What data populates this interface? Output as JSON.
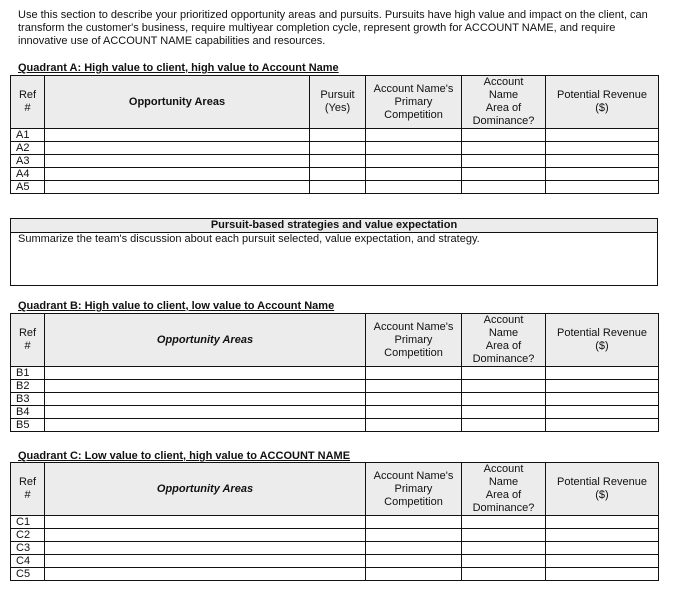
{
  "intro": "Use this section to describe your prioritized opportunity areas and pursuits.  Pursuits have high value and impact on the client, can transform the customer's business, require multiyear completion cycle, represent growth for ACCOUNT NAME, and require innovative use of ACCOUNT NAME capabilities and resources.",
  "quadrant_a": {
    "title": "Quadrant A: High value to client, high value to Account Name",
    "headers": {
      "ref_line1": "Ref",
      "ref_line2": "#",
      "opportunity": "Opportunity Areas",
      "pursuit_line1": "Pursuit",
      "pursuit_line2": "(Yes)",
      "competition_line1": "Account Name's",
      "competition_line2": "Primary",
      "competition_line3": "Competition",
      "dominance_line1": "Account",
      "dominance_line2": "Name",
      "dominance_line3": "Area of",
      "dominance_line4": "Dominance?",
      "revenue_line1": "Potential Revenue",
      "revenue_line2": "($)"
    },
    "rows": [
      "A1",
      "A2",
      "A3",
      "A4",
      "A5"
    ]
  },
  "pursuit_section": {
    "title": "Pursuit-based strategies and value expectation",
    "prompt": "Summarize the team's discussion about each pursuit selected, value expectation, and strategy."
  },
  "quadrant_b": {
    "title": "Quadrant B: High value to client, low value to Account Name",
    "headers": {
      "ref_line1": "Ref",
      "ref_line2": "#",
      "opportunity": "Opportunity Areas",
      "competition_line1": "Account Name's",
      "competition_line2": "Primary",
      "competition_line3": "Competition",
      "dominance_line1": "Account",
      "dominance_line2": "Name",
      "dominance_line3": "Area of",
      "dominance_line4": "Dominance?",
      "revenue_line1": "Potential Revenue",
      "revenue_line2": "($)"
    },
    "rows": [
      "B1",
      "B2",
      "B3",
      "B4",
      "B5"
    ]
  },
  "quadrant_c": {
    "title": "Quadrant C: Low value to client, high value to ACCOUNT NAME",
    "headers": {
      "ref_line1": "Ref",
      "ref_line2": "#",
      "opportunity": "Opportunity Areas",
      "competition_line1": "Account Name's",
      "competition_line2": "Primary",
      "competition_line3": "Competition",
      "dominance_line1": "Account",
      "dominance_line2": "Name",
      "dominance_line3": "Area of",
      "dominance_line4": "Dominance?",
      "revenue_line1": "Potential Revenue",
      "revenue_line2": "($)"
    },
    "rows": [
      "C1",
      "C2",
      "C3",
      "C4",
      "C5"
    ]
  }
}
